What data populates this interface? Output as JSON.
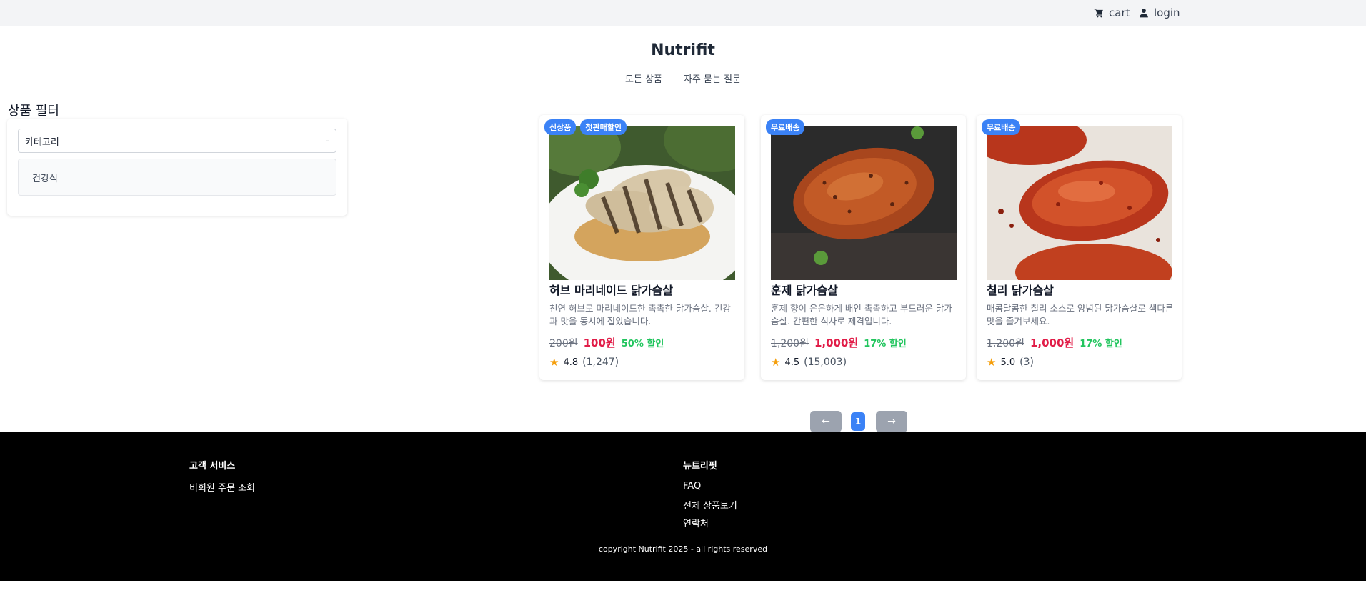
{
  "topbar": {
    "cart_label": "cart",
    "login_label": "login"
  },
  "header": {
    "brand": "Nutrifit",
    "nav": [
      "모든 상품",
      "자주 묻는 질문"
    ]
  },
  "filter": {
    "title": "상품 필터",
    "select_label": "카테고리",
    "select_indicator": "-",
    "options": [
      "건강식"
    ]
  },
  "products": [
    {
      "badges": [
        "신상품",
        "첫판매할인"
      ],
      "name": "허브 마리네이드 닭가슴살",
      "description": "천연 허브로 마리네이드한 촉촉한 닭가슴살. 건강과 맛을 동시에 잡았습니다.",
      "original_price": "200원",
      "sale_price": "100원",
      "discount": "50% 할인",
      "rating": "4.8",
      "review_count": "(1,247)",
      "image_icon": "grilled-chicken-plate"
    },
    {
      "badges": [
        "무료배송"
      ],
      "name": "훈제 닭가슴살",
      "description": "훈제 향이 은은하게 배인 촉촉하고 부드러운 닭가슴살. 간편한 식사로 제격입니다.",
      "original_price": "1,200원",
      "sale_price": "1,000원",
      "discount": "17% 할인",
      "rating": "4.5",
      "review_count": "(15,003)",
      "image_icon": "smoked-chicken-breast"
    },
    {
      "badges": [
        "무료배송"
      ],
      "name": "칠리 닭가슴살",
      "description": "매콤달콤한 칠리 소스로 양념된 닭가슴살로 색다른 맛을 즐겨보세요.",
      "original_price": "1,200원",
      "sale_price": "1,000원",
      "discount": "17% 할인",
      "rating": "5.0",
      "review_count": "(3)",
      "image_icon": "chili-chicken-breast"
    }
  ],
  "pagination": {
    "prev": "←",
    "current_page": "1",
    "next": "→"
  },
  "footer": {
    "customer_service": {
      "heading": "고객 서비스",
      "links": [
        "비회원 주문 조회"
      ]
    },
    "nutrifit": {
      "heading": "뉴트리핏",
      "links": [
        "FAQ",
        "전체 상품보기",
        "연락처"
      ]
    },
    "copyright": "copyright Nutrifit 2025 - all rights reserved"
  },
  "colors": {
    "accent": "#3b82f6",
    "sale_price": "#e11d48",
    "discount": "#22c55e",
    "star": "#f59e0b",
    "topbar_bg": "#f3f4f6",
    "footer_bg": "#000000"
  }
}
